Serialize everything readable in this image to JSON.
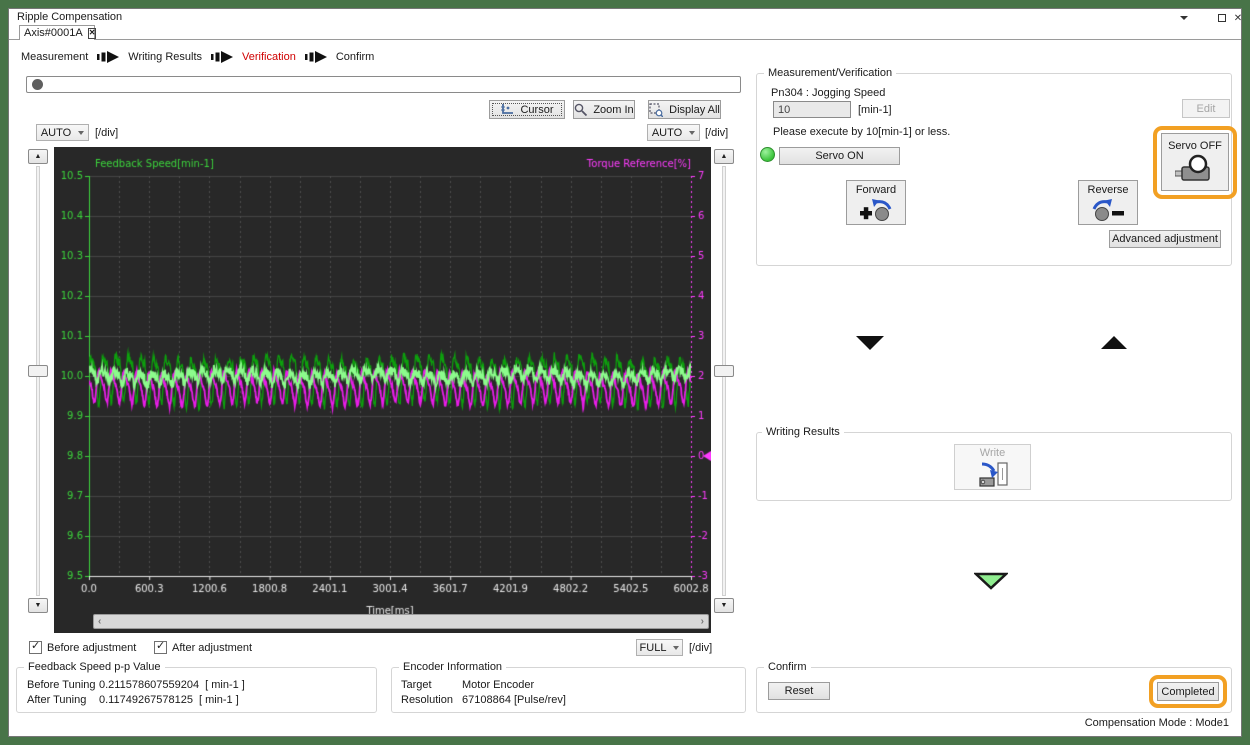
{
  "window": {
    "title": "Ripple Compensation"
  },
  "tab": {
    "label": "Axis#0001A"
  },
  "steps": {
    "items": [
      {
        "label": "Measurement"
      },
      {
        "label": "Writing Results"
      },
      {
        "label": "Verification"
      },
      {
        "label": "Confirm"
      }
    ],
    "active": "Verification"
  },
  "toolbar": {
    "cursor_label": "Cursor",
    "zoom_in_label": "Zoom In",
    "display_all_label": "Display All"
  },
  "scales": {
    "y_left": "AUTO",
    "y_right": "AUTO",
    "x": "FULL",
    "unit": "[/div]"
  },
  "legend": {
    "before_label": "Before adjustment",
    "after_label": "After adjustment",
    "before_checked": true,
    "after_checked": true
  },
  "chart_data": {
    "type": "line",
    "x_axis": {
      "label": "Time[ms]",
      "min": 0,
      "max": 6002.8,
      "ticks": [
        "0.0",
        "600.3",
        "1200.6",
        "1800.8",
        "2401.1",
        "3001.4",
        "3601.7",
        "4201.9",
        "4802.2",
        "5402.5",
        "6002.8"
      ]
    },
    "left_axis": {
      "label": "Feedback Speed[min-1]",
      "min": 9.5,
      "max": 10.5,
      "ticks": [
        "10.5",
        "10.4",
        "10.3",
        "10.2",
        "10.1",
        "10.0",
        "9.9",
        "9.8",
        "9.7",
        "9.6",
        "9.5"
      ],
      "color": "#3cd43c"
    },
    "right_axis": {
      "label": "Torque Reference[%]",
      "min": -3,
      "max": 7,
      "ticks": [
        "7",
        "6",
        "5",
        "4",
        "3",
        "2",
        "1",
        "0",
        "-1",
        "-2",
        "-3"
      ],
      "color": "#ff3cff",
      "zero_marker": 0
    },
    "series": [
      {
        "name": "Before adjustment",
        "axis": "left",
        "color": "#0da00d",
        "mean": 10.0,
        "amplitude": 0.052,
        "amplitude2": 0.02,
        "period_ms": 125,
        "noise": 0.01,
        "width": 1.3
      },
      {
        "name": "Torque Reference",
        "axis": "right",
        "color": "#e81ee8",
        "mean": 1.72,
        "amplitude": 0.34,
        "amplitude2": 0.12,
        "period_ms": 125,
        "noise": 0.05,
        "width": 1.8
      },
      {
        "name": "After adjustment",
        "axis": "left",
        "color": "#8cfc8c",
        "mean": 10.0,
        "amplitude": 0.013,
        "amplitude2": 0.005,
        "period_ms": 125,
        "noise": 0.011,
        "width": 1.6
      }
    ],
    "grid": {
      "bg": "#282828",
      "h_color": "#454545",
      "v_color": "#4e4e4e"
    }
  },
  "measurement": {
    "title": "Measurement/Verification",
    "param_label": "Pn304 : Jogging Speed",
    "speed_value": "10",
    "speed_unit": "[min-1]",
    "edit_label": "Edit",
    "note": "Please execute by 10[min-1] or less.",
    "servo_on_label": "Servo ON",
    "servo_off_label": "Servo OFF",
    "forward_label": "Forward",
    "reverse_label": "Reverse",
    "advanced_label": "Advanced adjustment"
  },
  "writing": {
    "title": "Writing Results",
    "write_label": "Write"
  },
  "confirm": {
    "title": "Confirm",
    "reset_label": "Reset",
    "completed_label": "Completed"
  },
  "pp_value": {
    "title": "Feedback Speed p-p Value",
    "rows": [
      {
        "label": "Before Tuning",
        "value": "0.211578607559204",
        "unit": "[ min-1 ]"
      },
      {
        "label": "After Tuning",
        "value": "0.11749267578125",
        "unit": "[ min-1 ]"
      }
    ]
  },
  "encoder": {
    "title": "Encoder Information",
    "rows": [
      {
        "label": "Target",
        "value": "Motor Encoder"
      },
      {
        "label": "Resolution",
        "value": "67108864 [Pulse/rev]"
      }
    ]
  },
  "status": {
    "text": "Compensation Mode : Mode1"
  },
  "colors": {
    "highlight_ring": "#f2a023",
    "step_active": "#d00000",
    "chart_bg": "#282828"
  }
}
